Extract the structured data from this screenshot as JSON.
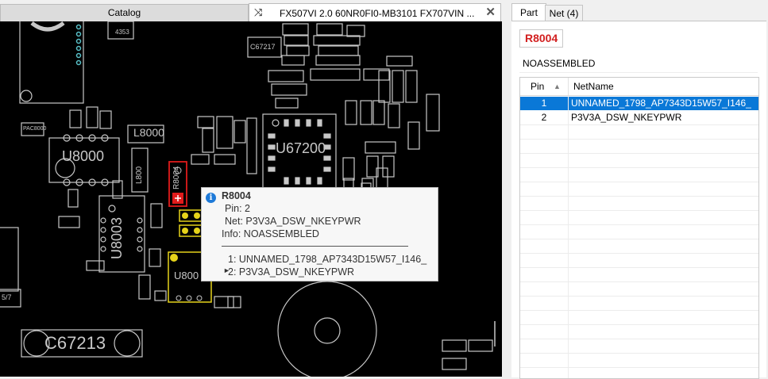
{
  "tabs": {
    "catalog_label": "Catalog",
    "board_tab_label": "FX507VI 2.0 60NR0FI0-MB3101 FX707VIN ...",
    "shuffle_icon": "shuffle-icon",
    "close_icon": "close-icon"
  },
  "board": {
    "labels": {
      "u8000": "U8000",
      "u8003": "U8003",
      "u800x": "U800",
      "u67200": "U67200",
      "c67213": "C67213",
      "l8000": "L8000",
      "l800x": "L800",
      "r8004": "R8004",
      "pac": "PAC8000",
      "c67217": "C67217",
      "s4353": "4353",
      "c5p7": "5/7"
    }
  },
  "popup": {
    "icon": "info-icon",
    "title": "R8004",
    "pin": "Pin: 2",
    "net": "Net: P3V3A_DSW_NKEYPWR",
    "info": "Info: NOASSEMBLED",
    "nets": [
      "1: UNNAMED_1798_AP7343D15W57_I146_",
      "2: P3V3A_DSW_NKEYPWR"
    ]
  },
  "panel": {
    "tab_part": "Part",
    "tab_net": "Net (4)",
    "refdes": "R8004",
    "assembly": "NOASSEMBLED",
    "col_pin": "Pin",
    "col_netname": "NetName",
    "rows": [
      {
        "pin": "1",
        "net": "UNNAMED_1798_AP7343D15W57_I146_",
        "selected": true
      },
      {
        "pin": "2",
        "net": "P3V3A_DSW_NKEYPWR",
        "selected": false
      }
    ]
  },
  "colors": {
    "board_bg": "#000000",
    "silkscreen": "#c8c8c8",
    "highlight_red": "#e01b1b",
    "pad_yellow": "#e6d31a",
    "selection_blue": "#0a78d7",
    "refdes_red": "#d21f1f",
    "info_blue": "#1e7ad8"
  }
}
